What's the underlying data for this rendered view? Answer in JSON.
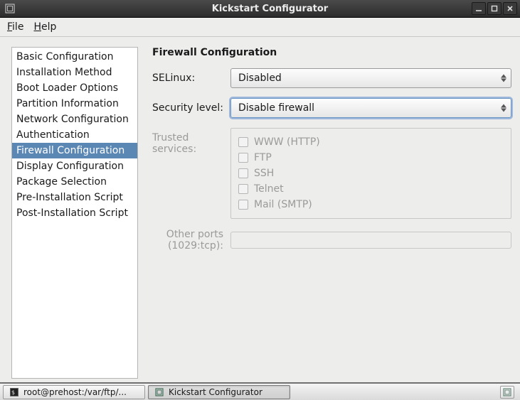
{
  "window": {
    "title": "Kickstart Configurator"
  },
  "menubar": {
    "file": "File",
    "help": "Help"
  },
  "sidebar": {
    "items": [
      "Basic Configuration",
      "Installation Method",
      "Boot Loader Options",
      "Partition Information",
      "Network Configuration",
      "Authentication",
      "Firewall Configuration",
      "Display Configuration",
      "Package Selection",
      "Pre-Installation Script",
      "Post-Installation Script"
    ],
    "selected_index": 6
  },
  "content": {
    "heading": "Firewall Configuration",
    "selinux_label": "SELinux:",
    "selinux_value": "Disabled",
    "seclevel_label": "Security level:",
    "seclevel_value": "Disable firewall",
    "trusted_label": "Trusted services:",
    "services": [
      "WWW (HTTP)",
      "FTP",
      "SSH",
      "Telnet",
      "Mail (SMTP)"
    ],
    "other_ports_label": "Other ports (1029:tcp):"
  },
  "taskbar": {
    "task1": "root@prehost:/var/ftp/...",
    "task2": "Kickstart Configurator"
  }
}
